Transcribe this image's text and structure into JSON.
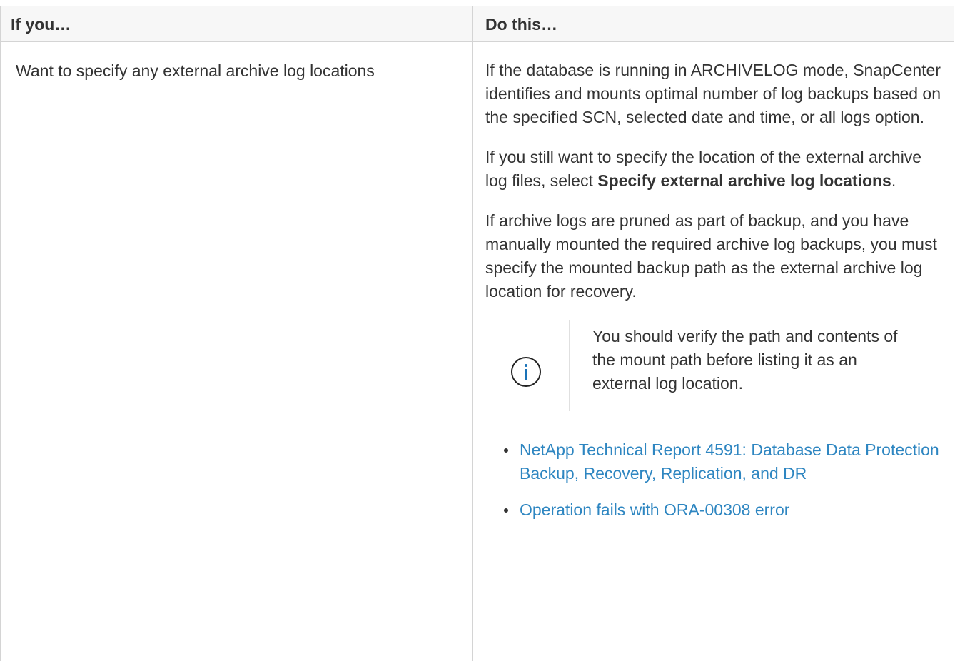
{
  "table": {
    "headers": [
      "If you…",
      "Do this…"
    ],
    "row": {
      "condition": "Want to specify any external archive log locations",
      "paragraph1": "If the database is running in ARCHIVELOG mode, SnapCenter identifies and mounts optimal number of log backups based on the specified SCN, selected date and time, or all logs option.",
      "paragraph2_prefix": "If you still want to specify the location of the external archive log files, select ",
      "paragraph2_bold": "Specify external archive log locations",
      "paragraph2_suffix": ".",
      "paragraph3": "If archive logs are pruned as part of backup, and you have manually mounted the required archive log backups, you must specify the mounted backup path as the external archive log location for recovery.",
      "note": {
        "icon": "info-icon",
        "text": "You should verify the path and contents of the mount path before listing it as an external log location."
      },
      "links": [
        "NetApp Technical Report 4591: Database Data Protection Backup, Recovery, Replication, and DR",
        "Operation fails with ORA-00308 error"
      ]
    }
  },
  "colors": {
    "link": "#2e86c1",
    "text": "#333333",
    "header_bg": "#f7f7f7",
    "border": "#d4d4d4"
  }
}
